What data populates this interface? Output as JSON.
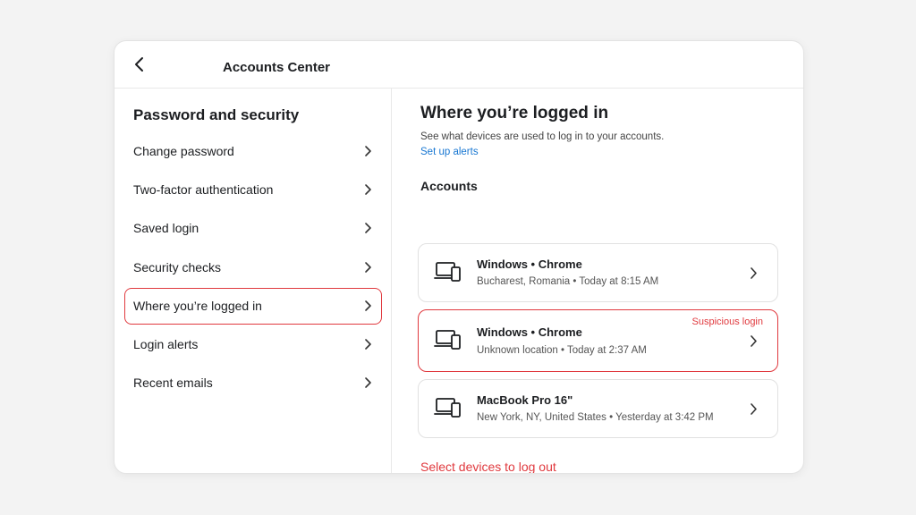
{
  "header": {
    "title": "Accounts Center",
    "back_icon": "chevron-left-icon"
  },
  "sidebar": {
    "heading": "Password and security",
    "items": [
      {
        "label": "Change password"
      },
      {
        "label": "Two-factor authentication"
      },
      {
        "label": "Saved login"
      },
      {
        "label": "Security checks"
      },
      {
        "label": "Where you’re logged in",
        "active": true
      },
      {
        "label": "Login alerts"
      },
      {
        "label": "Recent emails"
      }
    ]
  },
  "main": {
    "title": "Where you’re logged in",
    "description": "See what devices are used to log in to your accounts.",
    "alerts_link": "Set up alerts",
    "section_label": "Accounts",
    "devices": [
      {
        "name": "Windows • Chrome",
        "detail": "Bucharest, Romania • Today at 8:15 AM",
        "suspicious": false
      },
      {
        "name": "Windows • Chrome",
        "detail": "Unknown location • Today at 2:37 AM",
        "suspicious": true,
        "badge": "Suspicious login"
      },
      {
        "name": "MacBook Pro 16\"",
        "detail": "New York, NY, United States • Yesterday at 3:42 PM",
        "suspicious": false
      }
    ],
    "logout_link": "Select devices to log out"
  },
  "colors": {
    "accent_red": "#e0393e",
    "link_blue": "#1877d2"
  }
}
